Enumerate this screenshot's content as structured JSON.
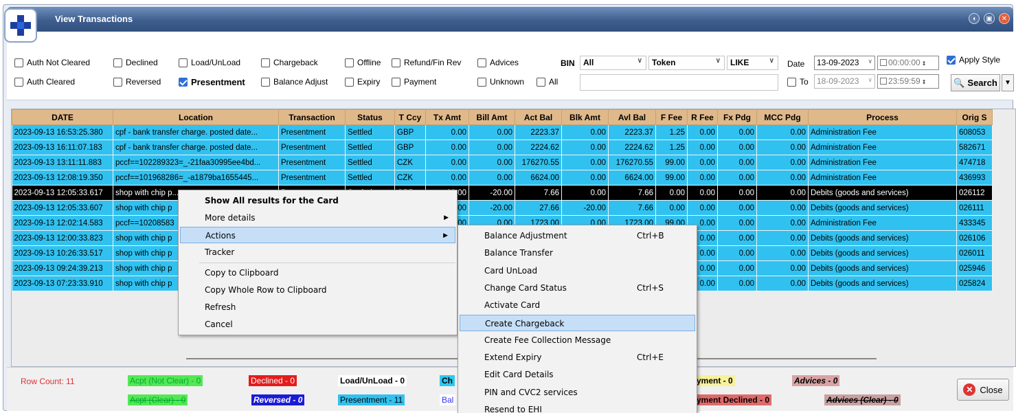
{
  "window": {
    "title": "View Transactions"
  },
  "filters": {
    "auth_not_cleared": "Auth Not Cleared",
    "auth_cleared": "Auth Cleared",
    "declined": "Declined",
    "reversed": "Reversed",
    "load_unload": "Load/UnLoad",
    "presentment": "Presentment",
    "chargeback": "Chargeback",
    "balance_adjust": "Balance Adjust",
    "offline": "Offline",
    "expiry": "Expiry",
    "refund": "Refund/Fin Rev",
    "payment": "Payment",
    "advices": "Advices",
    "unknown": "Unknown",
    "all": "All",
    "bin_label": "BIN",
    "bin_value": "All",
    "token_value": "Token",
    "like_value": "LIKE",
    "date_label": "Date",
    "to_label": "To",
    "date_from": "13-09-2023",
    "time_from": "00:00:00",
    "date_to": "18-09-2023",
    "time_to": "23:59:59",
    "apply_style": "Apply Style",
    "search": "Search"
  },
  "grid": {
    "columns": [
      "DATE",
      "Location",
      "Transaction",
      "Status",
      "T Ccy",
      "Tx Amt",
      "Bill Amt",
      "Act Bal",
      "Blk Amt",
      "Avl Bal",
      "F Fee",
      "R Fee",
      "Fx Pdg",
      "MCC Pdg",
      "Process",
      "Orig S"
    ],
    "rows": [
      [
        "2023-09-13 16:53:25.380",
        "cpf - bank transfer charge. posted date...",
        "Presentment",
        "Settled",
        "GBP",
        "0.00",
        "0.00",
        "2223.37",
        "0.00",
        "2223.37",
        "1.25",
        "0.00",
        "0.00",
        "0.00",
        "Administration Fee",
        "608053"
      ],
      [
        "2023-09-13 16:11:07.183",
        "cpf - bank transfer charge. posted date...",
        "Presentment",
        "Settled",
        "GBP",
        "0.00",
        "0.00",
        "2224.62",
        "0.00",
        "2224.62",
        "1.25",
        "0.00",
        "0.00",
        "0.00",
        "Administration Fee",
        "582671"
      ],
      [
        "2023-09-13 13:11:11.883",
        "pccf==102289323=_-21faa30995ee4bd...",
        "Presentment",
        "Settled",
        "CZK",
        "0.00",
        "0.00",
        "176270.55",
        "0.00",
        "176270.55",
        "99.00",
        "0.00",
        "0.00",
        "0.00",
        "Administration Fee",
        "474718"
      ],
      [
        "2023-09-13 12:08:19.350",
        "pccf==101968286=_-a1879ba1655445...",
        "Presentment",
        "Settled",
        "CZK",
        "0.00",
        "0.00",
        "6624.00",
        "0.00",
        "6624.00",
        "99.00",
        "0.00",
        "0.00",
        "0.00",
        "Administration Fee",
        "436993"
      ],
      [
        "2023-09-13 12:05:33.617",
        "shop with chip p...",
        "Presentment",
        "Settled",
        "GBP",
        "-20.00",
        "-20.00",
        "7.66",
        "0.00",
        "7.66",
        "0.00",
        "0.00",
        "0.00",
        "0.00",
        "Debits (goods and services)",
        "026112"
      ],
      [
        "2023-09-13 12:05:33.607",
        "shop with chip p",
        "",
        "",
        "",
        "-20.00",
        "-20.00",
        "27.66",
        "-20.00",
        "7.66",
        "0.00",
        "0.00",
        "0.00",
        "0.00",
        "Debits (goods and services)",
        "026111"
      ],
      [
        "2023-09-13 12:02:14.583",
        "pccf==10208583",
        "",
        "",
        "",
        "0.00",
        "0.00",
        "1723.00",
        "0.00",
        "1723.00",
        "99.00",
        "0.00",
        "0.00",
        "0.00",
        "Administration Fee",
        "433345"
      ],
      [
        "2023-09-13 12:00:33.823",
        "shop with chip p",
        "",
        "",
        "",
        "",
        "",
        "",
        "",
        "",
        "0",
        "0.00",
        "0.00",
        "0.00",
        "Debits (goods and services)",
        "026106"
      ],
      [
        "2023-09-13 10:26:33.517",
        "shop with chip p",
        "",
        "",
        "",
        "",
        "",
        "",
        "",
        "",
        "0",
        "0.00",
        "0.00",
        "0.00",
        "Debits (goods and services)",
        "026011"
      ],
      [
        "2023-09-13 09:24:39.213",
        "shop with chip p",
        "",
        "",
        "",
        "",
        "",
        "",
        "",
        "",
        "0",
        "0.00",
        "0.00",
        "0.00",
        "Debits (goods and services)",
        "025946"
      ],
      [
        "2023-09-13 07:23:33.910",
        "shop with chip p",
        "",
        "",
        "",
        "",
        "",
        "",
        "",
        "",
        "0",
        "0.00",
        "0.00",
        "0.00",
        "Debits (goods and services)",
        "025824"
      ]
    ]
  },
  "context_menu": {
    "items": [
      "Show All results for the Card",
      "More details",
      "Actions",
      "Tracker",
      "Copy to Clipboard",
      "Copy Whole Row to Clipboard",
      "Refresh",
      "Cancel"
    ]
  },
  "actions_menu": {
    "items": [
      {
        "label": "Balance Adjustment",
        "shortcut": "Ctrl+B"
      },
      {
        "label": "Balance Transfer",
        "shortcut": ""
      },
      {
        "label": "Card UnLoad",
        "shortcut": ""
      },
      {
        "label": "Change Card Status",
        "shortcut": "Ctrl+S"
      },
      {
        "label": "Activate Card",
        "shortcut": ""
      },
      {
        "label": "Create Chargeback",
        "shortcut": ""
      },
      {
        "label": "Create Fee Collection Message",
        "shortcut": ""
      },
      {
        "label": "Extend Expiry",
        "shortcut": "Ctrl+E"
      },
      {
        "label": "Edit Card Details",
        "shortcut": ""
      },
      {
        "label": "PIN and CVC2 services",
        "shortcut": ""
      },
      {
        "label": "Resend to EHI",
        "shortcut": ""
      }
    ]
  },
  "footer": {
    "row_count": "Row Count: 11",
    "acpt_not_clear": "Acpt (Not Clear) - 0",
    "acpt_clear": "Acpt (Clear) - 0",
    "declined": "Declined - 0",
    "reversed": "Reversed - 0",
    "load_unload": "Load/UnLoad - 0",
    "presentment": "Presentment - 11",
    "ch": "Ch",
    "bal": "Bal",
    "payment": "yment - 0",
    "payment_declined": "yment Declined - 0",
    "advices": "Advices - 0",
    "advices_clear": "Advices (Clear) - 0",
    "close": "Close"
  },
  "colors": {
    "row_blue": "#31c1f0",
    "header_tan": "#e0b98b",
    "selected_row": "#000000",
    "title_blue": "#3e5e8e"
  }
}
